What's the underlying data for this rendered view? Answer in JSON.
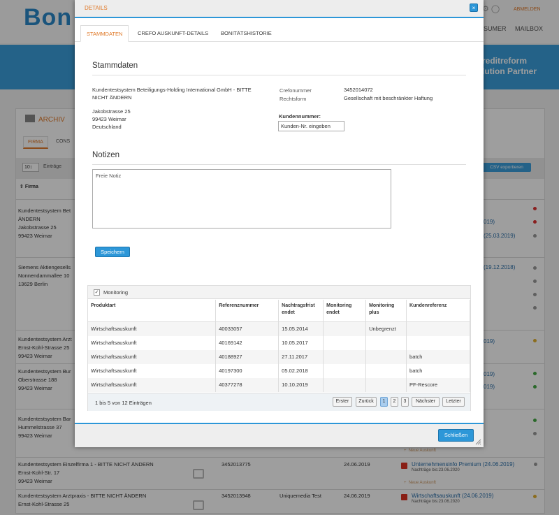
{
  "background": {
    "logo": "Bon",
    "logout": "ABMELDEN",
    "nav": [
      "SUMER",
      "MAILBOX"
    ],
    "banner_line1": "reditreform",
    "banner_line2": "lution Partner",
    "archiv": "ARCHIV",
    "tab_firma": "FIRMA",
    "tab_cons": "CONS",
    "page_size": "10↕",
    "entries_label": "Einträge",
    "csv_button": "CSV exportieren",
    "col_firma": "Firma",
    "rows": [
      {
        "name": "Kundentestsystem Bet",
        "l2": "ÄNDERN",
        "l3": "Jakobstrasse 25",
        "l4": "99423 Weimar",
        "right1": "019)",
        "right2": "(25.03.2019)"
      },
      {
        "name": "Siemens Aktiengesells",
        "l2": "Nonnendammallee 10",
        "l3": "13629 Berlin",
        "right1": "(19.12.2018)"
      },
      {
        "name": "Kundentestsystem Arzt",
        "l2": "Ernst-Kohl-Strasse 25",
        "l3": "99423 Weimar",
        "right1": "019)"
      },
      {
        "name": "Kundentestsystem Bur",
        "l2": "Oberstrasse 188",
        "l3": "99423 Weimar",
        "right1": "019)",
        "right2": "019)"
      },
      {
        "name": "Kundentestsystem Bar",
        "l2": "Hummelstrasse 37",
        "l3": "99423 Weimar"
      },
      {
        "name": "Kundentestsystem Einzelfirma 1 - BITTE NICHT ÄNDERN",
        "l2": "Ernst-Kohl-Str. 17",
        "l3": "99423 Weimar",
        "crefo": "3452013775",
        "date": "24.06.2019",
        "report": "Unternehmensinfo Premium (24.06.2019)",
        "sub": "Nachträge bis:23.06.2020",
        "neu": "Neue Auskunft"
      },
      {
        "name": "Kundentestsystem Arztpraxis - BITTE NICHT ÄNDERN",
        "l2": "Ernst-Kohl-Strasse 25",
        "crefo": "3452013948",
        "ref": "Uniquemedia Test",
        "date": "24.06.2019",
        "report": "Wirtschaftsauskunft (24.06.2019)",
        "sub": "Nachträge bis:23.06.2020"
      }
    ],
    "neu_auskunft_top": "Neue Auskunft"
  },
  "modal": {
    "title": "DETAILS",
    "tabs": [
      "STAMMDATEN",
      "CREFO AUSKUNFT-DETAILS",
      "BONITÄTSHISTORIE"
    ],
    "stammdaten_heading": "Stammdaten",
    "company_line1": "Kundentestsystem Beteiligungs-Holding International GmbH - BITTE",
    "company_line2": "NICHT ÄNDERN",
    "street": "Jakobstrasse 25",
    "city": "99423 Weimar",
    "country": "Deutschland",
    "crefo_label": "Crefonummer",
    "crefo_value": "3452014072",
    "rechtsform_label": "Rechtsform",
    "rechtsform_value": "Gesellschaft mit beschränkter Haftung",
    "kundennummer_label": "Kundennummer:",
    "kundennummer_placeholder": "Kunden-Nr. eingeben",
    "notizen_heading": "Notizen",
    "notiz_placeholder": "Freie Notiz",
    "save_button": "Speichern",
    "monitoring": {
      "checked": true,
      "label": "Monitoring",
      "columns": [
        "Produktart",
        "Referenznummer",
        "Nachtragsfrist endet",
        "Monitoring endet",
        "Monitoring plus",
        "Kundenreferenz"
      ],
      "rows": [
        [
          "Wirtschaftsauskunft",
          "40033057",
          "15.05.2014",
          "",
          "Unbegrenzt",
          ""
        ],
        [
          "Wirtschaftsauskunft",
          "40169142",
          "10.05.2017",
          "",
          "",
          ""
        ],
        [
          "Wirtschaftsauskunft",
          "40188927",
          "27.11.2017",
          "",
          "",
          "batch"
        ],
        [
          "Wirtschaftsauskunft",
          "40197300",
          "05.02.2018",
          "",
          "",
          "batch"
        ],
        [
          "Wirtschaftsauskunft",
          "40377278",
          "10.10.2019",
          "",
          "",
          "PF-Rescore"
        ]
      ],
      "info": "1 bis 5 von 12 Einträgen",
      "pagination": {
        "first": "Erster",
        "prev": "Zurück",
        "pages": [
          "1",
          "2",
          "3"
        ],
        "current": "1",
        "next": "Nächster",
        "last": "Letzter"
      }
    },
    "close_button": "Schließen"
  },
  "colors": {
    "accent": "#2d97d8",
    "orange": "#e07a2a"
  }
}
